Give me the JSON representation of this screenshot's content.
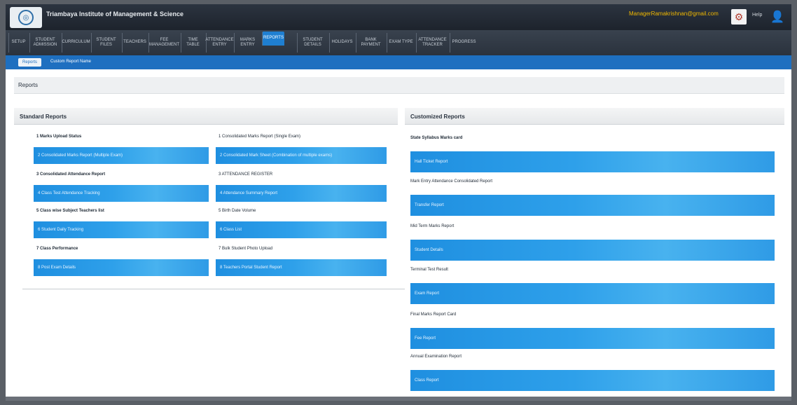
{
  "header": {
    "institute_name": "Triambaya Institute of Management & Science",
    "user_email": "ManagerRamakrishnan@gmail.com",
    "help_label": "Help"
  },
  "nav": {
    "tabs": [
      {
        "label": "SETUP"
      },
      {
        "label": "STUDENT ADMISSION"
      },
      {
        "label": "CURRICULUM"
      },
      {
        "label": "STUDENT FILES"
      },
      {
        "label": "TEACHERS"
      },
      {
        "label": "FEE MANAGEMENT"
      },
      {
        "label": "TIME TABLE"
      },
      {
        "label": "ATTENDANCE ENTRY"
      },
      {
        "label": "MARKS ENTRY"
      },
      {
        "label": "REPORTS"
      },
      {
        "label": "STUDENT DETAILS"
      },
      {
        "label": "HOLIDAYS"
      },
      {
        "label": "BANK PAYMENT"
      },
      {
        "label": "EXAM TYPE"
      },
      {
        "label": "ATTENDANCE TRACKER"
      },
      {
        "label": "PROGRESS"
      }
    ],
    "active_index": 9
  },
  "subnav": {
    "button_label": "Reports",
    "link_label": "Custom Report Name"
  },
  "page": {
    "title": "Reports"
  },
  "standard": {
    "title": "Standard Reports",
    "col1": [
      {
        "label": "1 Marks Upload Status",
        "button": "2 Consolidated Marks Report (Multiple Exam)"
      },
      {
        "label": "3 Consolidated Attendance Report",
        "button": "4 Class Test Attendance Tracking"
      },
      {
        "label": "5 Class wise Subject Teachers list",
        "button": "6 Student Daily Tracking"
      },
      {
        "label": "7 Class Performance",
        "button": "8 Post Exam Details"
      }
    ],
    "col2": [
      {
        "label": "1 Consolidated Marks Report (Single Exam)",
        "button": "2 Consolidated Mark Sheet (Combination of multiple exams)"
      },
      {
        "label": "3 ATTENDANCE REGISTER",
        "button": "4 Attendance Summary Report"
      },
      {
        "label": "5 Birth Date Volume",
        "button": "6 Class List"
      },
      {
        "label": "7 Bulk Student Photo Upload",
        "button": "8 Teachers Portal Student Report"
      }
    ]
  },
  "customized": {
    "title": "Customized Reports",
    "items": [
      {
        "label": "State Syllabus Marks card",
        "button": "Hall Ticket Report"
      },
      {
        "label": "Mark Entry Attendance Consolidated Report",
        "button": "Transfer Report"
      },
      {
        "label": "Mid Term Marks Report",
        "button": "Student Details"
      },
      {
        "label": "Terminal Test Result",
        "button": "Exam Report"
      },
      {
        "label": "Final Marks Report Card",
        "button": "Fee Report"
      },
      {
        "label": "Annual Examination Report",
        "button": "Class Report"
      }
    ]
  }
}
